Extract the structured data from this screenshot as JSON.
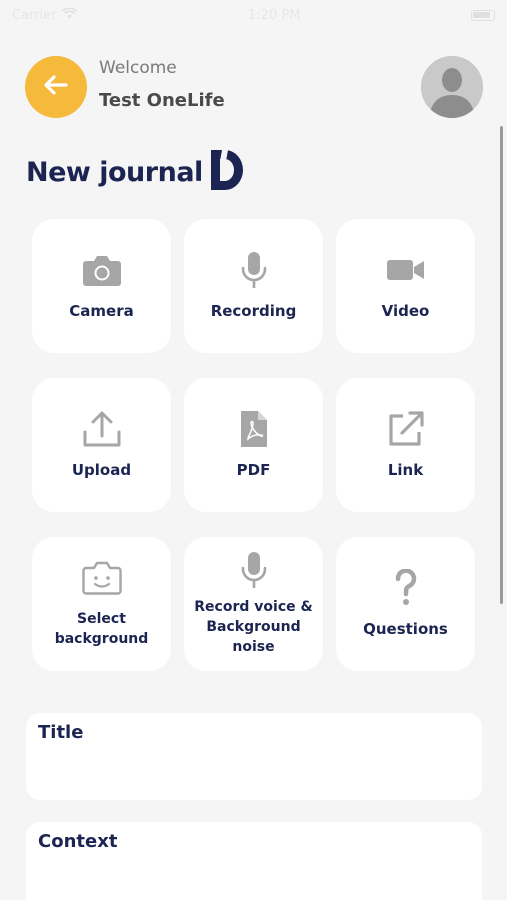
{
  "status_bar": {
    "carrier": "Carrier",
    "time": "1:20 PM"
  },
  "header": {
    "welcome": "Welcome",
    "user_name": "Test OneLife"
  },
  "page": {
    "title": "New journal"
  },
  "tiles": [
    {
      "label": "Camera",
      "icon": "camera-icon"
    },
    {
      "label": "Recording",
      "icon": "microphone-icon"
    },
    {
      "label": "Video",
      "icon": "video-camera-icon"
    },
    {
      "label": "Upload",
      "icon": "upload-icon"
    },
    {
      "label": "PDF",
      "icon": "pdf-file-icon"
    },
    {
      "label": "Link",
      "icon": "external-link-icon"
    },
    {
      "label": "Select\nbackground",
      "icon": "background-face-icon"
    },
    {
      "label": "Record voice &\nBackground\nnoise",
      "icon": "microphone-icon"
    },
    {
      "label": "Questions",
      "icon": "question-mark-icon"
    }
  ],
  "form": {
    "title_label": "Title",
    "context_label": "Context"
  },
  "colors": {
    "accent": "#f5b93c",
    "navy": "#1c2551",
    "icon_gray": "#a6a6a6",
    "background": "#f5f5f5"
  }
}
